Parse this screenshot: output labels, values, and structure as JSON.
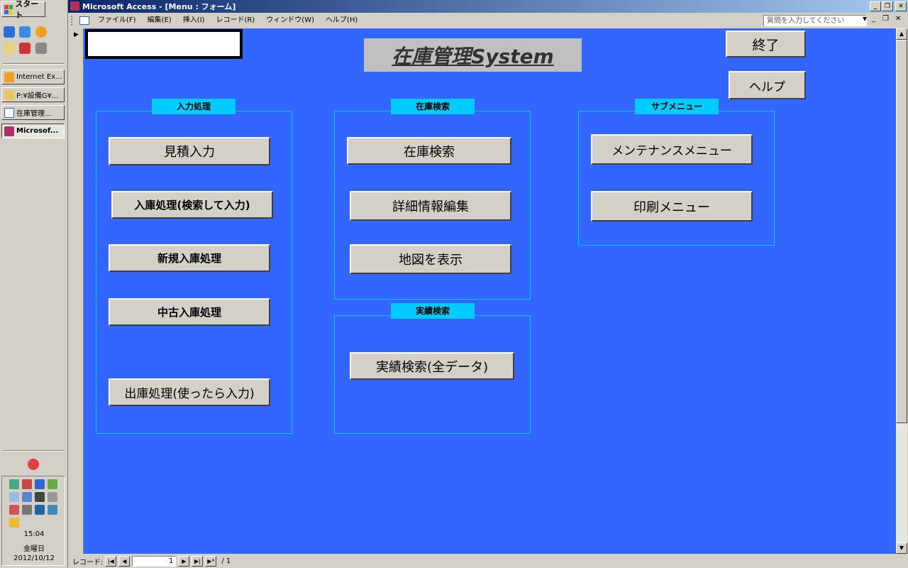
{
  "taskbar": {
    "start_label": "スタート",
    "items": [
      {
        "label": "Internet Ex..."
      },
      {
        "label": "P:¥設備G¥..."
      },
      {
        "label": "在庫管理..."
      },
      {
        "label": "Microsof..."
      }
    ],
    "clock": {
      "time": "15:04",
      "day": "金曜日",
      "date": "2012/10/12"
    }
  },
  "window": {
    "title": "Microsoft Access - [Menu : フォーム]",
    "menu": [
      "ファイル(F)",
      "編集(E)",
      "挿入(I)",
      "レコード(R)",
      "ウィンドウ(W)",
      "ヘルプ(H)"
    ],
    "help_placeholder": "質問を入力してください"
  },
  "form": {
    "title": "在庫管理System",
    "exit_button": "終了",
    "help_button": "ヘルプ",
    "groups": {
      "input": {
        "label": "入力処理",
        "buttons": [
          "見積入力",
          "入庫処理(検索して入力)",
          "新規入庫処理",
          "中古入庫処理",
          "出庫処理(使ったら入力)"
        ]
      },
      "stock_search": {
        "label": "在庫検索",
        "buttons": [
          "在庫検索",
          "詳細情報編集",
          "地図を表示"
        ]
      },
      "results_search": {
        "label": "実績検索",
        "buttons": [
          "実績検索(全データ)"
        ]
      },
      "submenu": {
        "label": "サブメニュー",
        "buttons": [
          "メンテナンスメニュー",
          "印刷メニュー"
        ]
      }
    }
  },
  "navigation": {
    "label": "レコード:",
    "current": "1",
    "total": "/ 1"
  }
}
